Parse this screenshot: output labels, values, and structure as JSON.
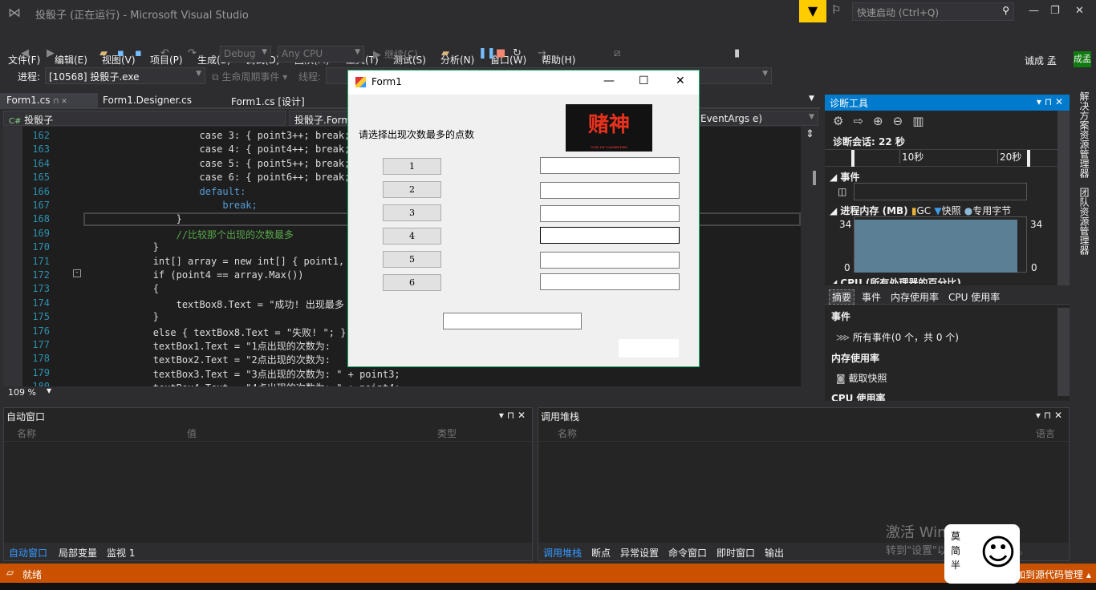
{
  "window": {
    "title": "投骰子 (正在运行) - Microsoft Visual Studio",
    "quick_launch_placeholder": "快速启动 (Ctrl+Q)",
    "user": "诚成 孟",
    "user_badge": "成孟"
  },
  "menu": [
    "文件(F)",
    "编辑(E)",
    "视图(V)",
    "项目(P)",
    "生成(B)",
    "调试(D)",
    "团队(M)",
    "工具(T)",
    "测试(S)",
    "分析(N)",
    "窗口(W)",
    "帮助(H)"
  ],
  "toolbar": {
    "config": "Debug",
    "platform": "Any CPU",
    "continue": "继续(C)"
  },
  "process_bar": {
    "label": "进程:",
    "process": "[10568] 投骰子.exe",
    "lifecycle": "生命周期事件",
    "thread_label": "线程:"
  },
  "doc_tabs": [
    {
      "label": "Form1.cs"
    },
    {
      "label": "Form1.Designer.cs"
    },
    {
      "label": "Form1.cs [设计]"
    }
  ],
  "nav": {
    "project": "投骰子",
    "class": "投骰子.Form",
    "member": "EventArgs e)"
  },
  "editor": {
    "zoom": "109 %",
    "lines": [
      {
        "n": "162",
        "code": "                    case 3: { point3++; break;"
      },
      {
        "n": "163",
        "code": "                    case 4: { point4++; break;"
      },
      {
        "n": "164",
        "code": "                    case 5: { point5++; break;"
      },
      {
        "n": "165",
        "code": "                    case 6: { point6++; break;"
      },
      {
        "n": "166",
        "code": "                    default:"
      },
      {
        "n": "167",
        "code": "                        break;"
      },
      {
        "n": "168",
        "code": "                }"
      },
      {
        "n": "169",
        "code": "                //比较那个出现的次数最多"
      },
      {
        "n": "170",
        "code": "            }"
      },
      {
        "n": "171",
        "code": "            int[] array = new int[] { point1, p"
      },
      {
        "n": "172",
        "code": "            if (point4 == array.Max())"
      },
      {
        "n": "173",
        "code": "            {"
      },
      {
        "n": "174",
        "code": "                textBox8.Text = \"成功! 出现最多"
      },
      {
        "n": "175",
        "code": "            }"
      },
      {
        "n": "176",
        "code": "            else { textBox8.Text = \"失败! \"; }"
      },
      {
        "n": "177",
        "code": "            textBox1.Text = \"1点出现的次数为: "
      },
      {
        "n": "178",
        "code": "            textBox2.Text = \"2点出现的次数为: "
      },
      {
        "n": "179",
        "code": "            textBox3.Text = \"3点出现的次数为: \" + point3;"
      },
      {
        "n": "180",
        "code": "            textBox4.Text = \"4点出现的次数为: \" + point4;"
      }
    ]
  },
  "form": {
    "title": "Form1",
    "label": "请选择出现次数最多的点数",
    "image_text": "赌神",
    "image_subtext": "GOD OF GAMBLERS",
    "buttons": [
      "1",
      "2",
      "3",
      "4",
      "5",
      "6"
    ]
  },
  "diag": {
    "title": "诊断工具",
    "session": "诊断会话: 22 秒",
    "ticks": [
      "10秒",
      "20秒"
    ],
    "events": "事件",
    "memory": "进程内存 (MB)",
    "gc": "GC",
    "snapshot": "快照",
    "private": "专用字节",
    "mem_max": "34",
    "mem_min": "0",
    "cpu": "CPU (所有处理器的百分比)",
    "tabs": [
      "摘要",
      "事件",
      "内存使用率",
      "CPU 使用率"
    ],
    "sec_events": "事件",
    "all_events": "所有事件(0 个，共 0 个)",
    "sec_memory": "内存使用率",
    "take_snapshot": "截取快照",
    "sec_cpu": "CPU 使用率",
    "accent": "#007acc",
    "mem_fill": "#5b7f95"
  },
  "right_tabs": [
    "解决方案资源管理器",
    "团队资源管理器"
  ],
  "auto_panel": {
    "title": "自动窗口",
    "cols": [
      "名称",
      "值",
      "类型"
    ],
    "tabs": [
      "自动窗口",
      "局部变量",
      "监视 1"
    ]
  },
  "stack_panel": {
    "title": "调用堆栈",
    "cols": [
      "名称",
      "语言"
    ],
    "tabs": [
      "调用堆栈",
      "断点",
      "异常设置",
      "命令窗口",
      "即时窗口",
      "输出"
    ]
  },
  "status": {
    "text": "就绪",
    "right": "添加到源代码管理",
    "color": "#ca5100"
  },
  "watermark": {
    "line1": "激活 Windows",
    "line2": "转到\"设置\"以激活 Windows。"
  },
  "sticker": {
    "text": "莫简半"
  }
}
